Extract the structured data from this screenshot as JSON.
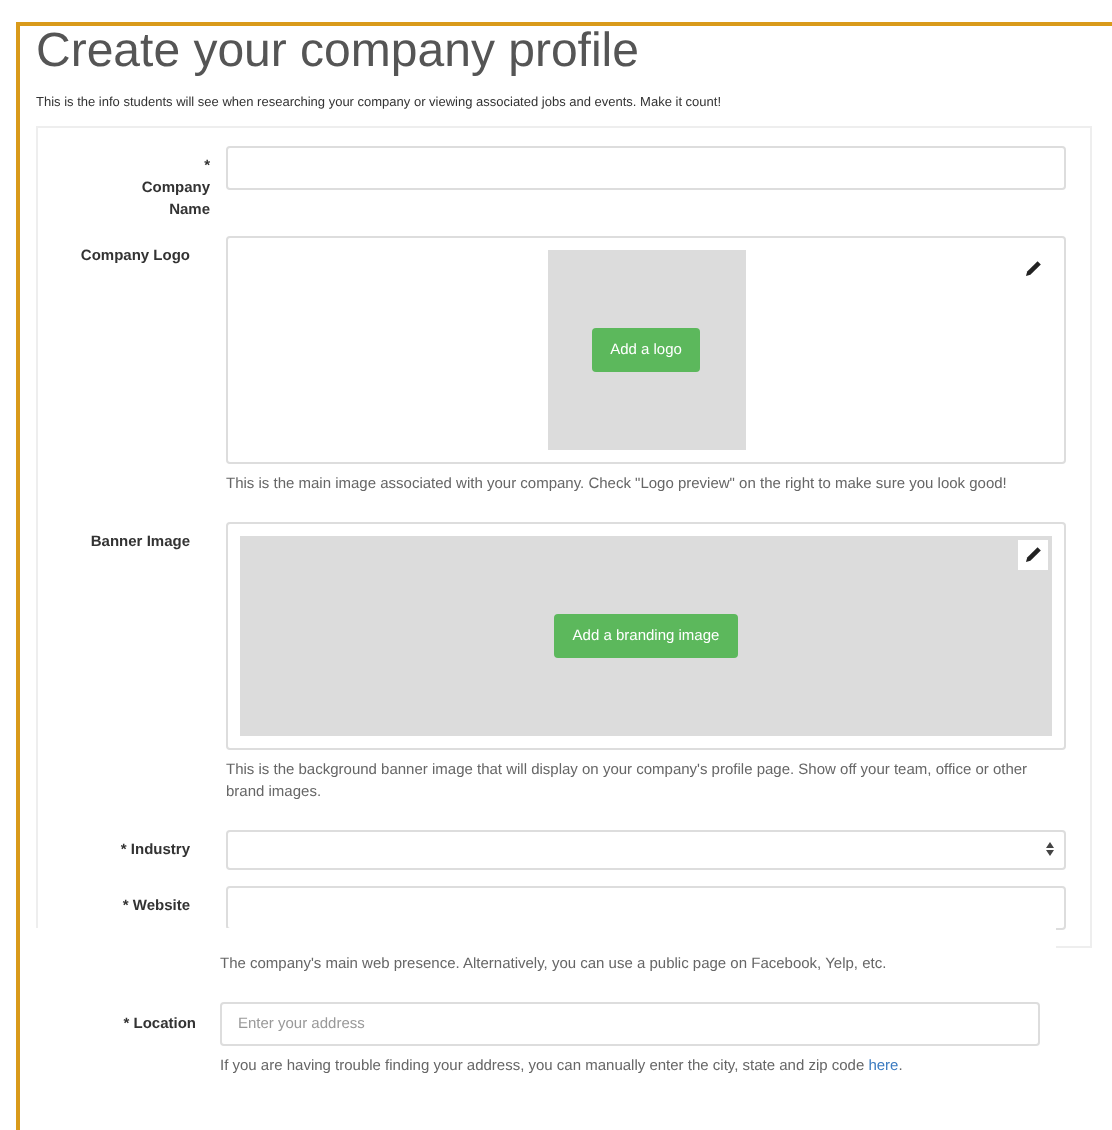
{
  "title": "Create your company profile",
  "subtitle": "This is the info students will see when researching your company or viewing associated jobs and events. Make it count!",
  "fields": [
    {
      "kind": "text",
      "label": "* Company Name"
    },
    {
      "kind": "logo",
      "label": "Company Logo",
      "button": "Add a logo",
      "help": "This is the main image associated with your company. Check \"Logo preview\" on the right to make sure you look good!"
    },
    {
      "kind": "banner",
      "label": "Banner Image",
      "button": "Add a branding image",
      "help": "This is the background banner image that will display on your company's profile page. Show off your team, office or other brand images."
    },
    {
      "kind": "select",
      "label": "* Industry"
    },
    {
      "kind": "text",
      "label": "* Website"
    }
  ],
  "location_panel": {
    "website_help": "The company's main web presence. Alternatively, you can use a public page on Facebook, Yelp, etc.",
    "label": "* Location",
    "placeholder": "Enter your address",
    "help": "If you are having trouble finding your address, you can manually enter the city, state and zip code",
    "link": "here",
    "help_end": "."
  }
}
